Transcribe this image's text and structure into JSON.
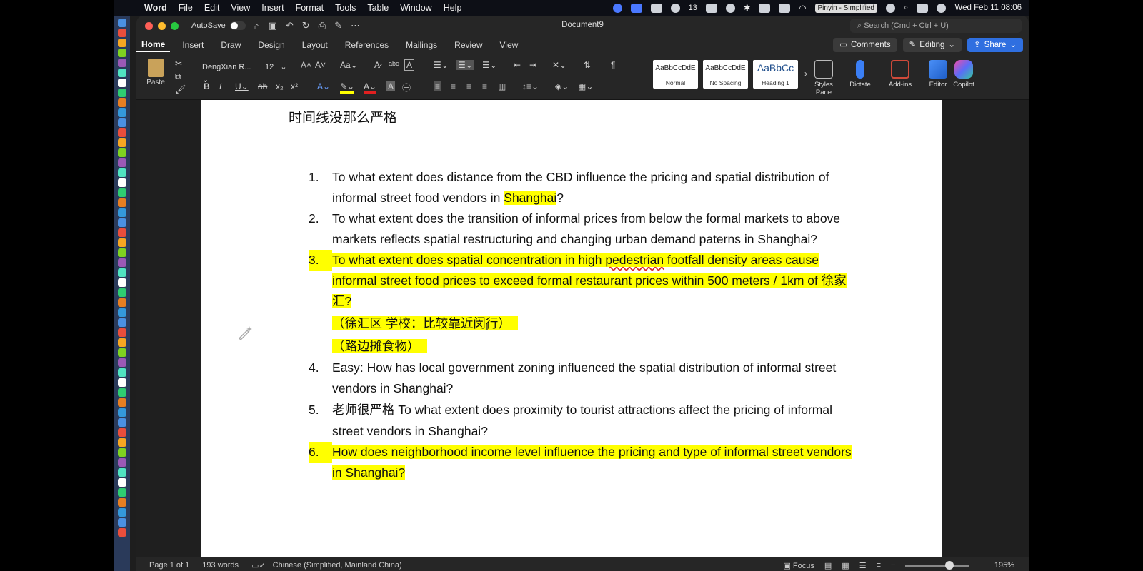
{
  "menubar": {
    "app": "Word",
    "items": [
      "File",
      "Edit",
      "View",
      "Insert",
      "Format",
      "Tools",
      "Table",
      "Window",
      "Help"
    ],
    "wechat_count": "13",
    "input_method": "Pinyin - Simplified",
    "datetime": "Wed Feb 11  08:06"
  },
  "titlebar": {
    "autosave": "AutoSave",
    "document_title": "Document9",
    "search_placeholder": "Search (Cmd + Ctrl + U)"
  },
  "ribbon": {
    "tabs": [
      "Home",
      "Insert",
      "Draw",
      "Design",
      "Layout",
      "References",
      "Mailings",
      "Review",
      "View"
    ],
    "comments": "Comments",
    "editing": "Editing",
    "share": "Share",
    "paste": "Paste",
    "font_name": "DengXian R...",
    "font_size": "12",
    "styles": [
      {
        "sample": "AaBbCcDdE",
        "name": "Normal"
      },
      {
        "sample": "AaBbCcDdE",
        "name": "No Spacing"
      },
      {
        "sample": "AaBbCc",
        "name": "Heading 1"
      }
    ],
    "styles_pane": "Styles Pane",
    "dictate": "Dictate",
    "addins": "Add-ins",
    "editor": "Editor",
    "copilot": "Copilot"
  },
  "document": {
    "heading": "时间线没那么严格",
    "questions": [
      {
        "num": "1.",
        "before": "To what extent does distance from the CBD influence the pricing and spatial distribution of informal street food vendors in ",
        "highlight": "Shanghai",
        "after": "?"
      },
      {
        "num": "2.",
        "text": "To what extent does the transition of informal prices from below the formal markets to above markets reflects spatial restructuring and changing urban demand paterns in Shanghai?"
      },
      {
        "num": "3.",
        "part1": "To what extent does spatial concentration in high ",
        "misspelled": "pedestrian",
        "part2": " footfall density areas cause informal street food prices to exceed formal restaurant prices within 500 meters / 1km of  徐家汇?",
        "sub1": "（徐汇区 学校：比较靠近闵行）",
        "sub2": "（路边摊食物）"
      },
      {
        "num": "4.",
        "text": "Easy: How has local government zoning influenced the spatial distribution of informal street vendors in Shanghai?"
      },
      {
        "num": "5.",
        "text": "老师很严格 To what extent does proximity to tourist attractions affect the pricing of informal street vendors in Shanghai?"
      },
      {
        "num": "6.",
        "text": "How does neighborhood income level influence the pricing and type of informal street vendors in Shanghai?"
      }
    ]
  },
  "statusbar": {
    "page": "Page 1 of 1",
    "words": "193 words",
    "language": "Chinese (Simplified, Mainland China)",
    "focus": "Focus",
    "zoom": "195%"
  }
}
